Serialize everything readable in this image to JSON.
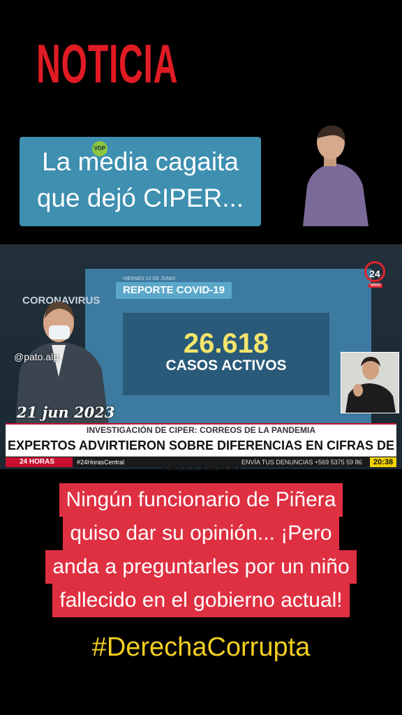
{
  "header": {
    "title": "NOTICIA"
  },
  "top_caption": {
    "text": "La media cagaita que dejó CIPER...",
    "line1": "La media cagaita",
    "line2": "que dejó CIPER...",
    "badge": "VDP"
  },
  "video": {
    "report_date": "VIERNES 12 DE JUNIO",
    "report_label": "REPORTE COVID-19",
    "big_number": "26.618",
    "big_number_label": "CASOS ACTIVOS",
    "background_text": "CORONAVIRUS",
    "channel_logo": "24",
    "live_label": "VIVO",
    "handle": "@pato.alp",
    "date_overlay": "21 jun 2023",
    "ticker_top": "INVESTIGACIÓN DE CIPER: CORREOS DE LA PANDEMIA",
    "ticker_main": "EXPERTOS ADVIRTIERON SOBRE DIFERENCIAS EN CIFRAS DE FALLECIDOS",
    "ticker_brand": "24 HORAS",
    "ticker_hashtag": "#24HorasCentral",
    "ticker_denuncias": "ENVÍA TUS DENUNCIAS  +569 5375 59 86",
    "clock": "20:38"
  },
  "bottom_caption": {
    "lines": [
      "Ningún funcionario de Piñera",
      "quiso dar su opinión... ¡Pero",
      "anda a preguntarles por un niño",
      "fallecido en el gobierno actual!"
    ]
  },
  "hashtag": "#DerechaCorrupta",
  "colors": {
    "headline_red": "#e01b24",
    "caption_blue": "#3e8fb0",
    "caption_red": "#df3042",
    "hashtag_yellow": "#f3cf1f"
  }
}
